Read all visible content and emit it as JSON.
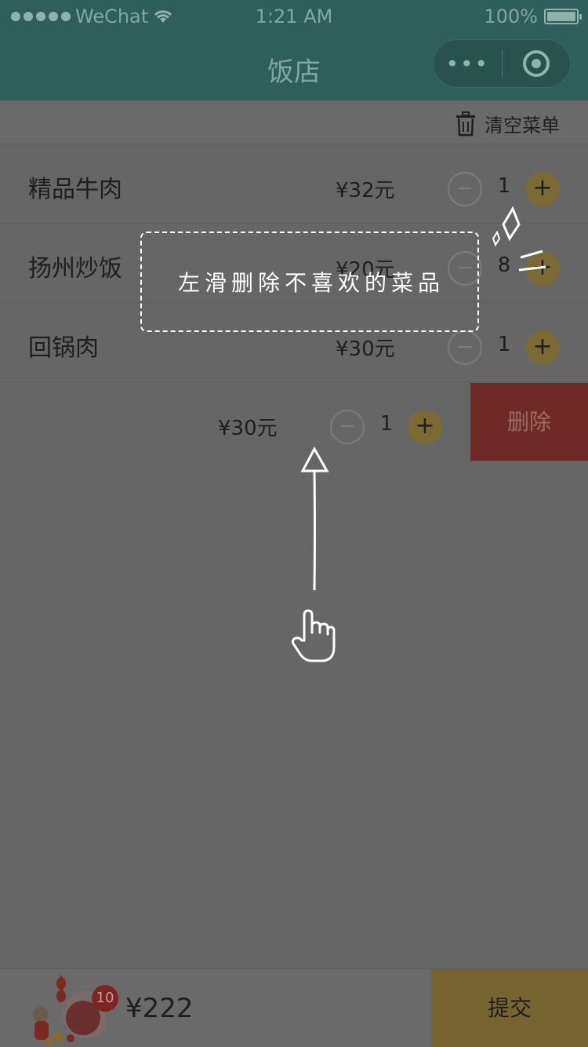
{
  "status_bar": {
    "carrier": "WeChat",
    "time": "1:21 AM",
    "battery": "100%"
  },
  "nav": {
    "title": "饭店",
    "more_label": "•••"
  },
  "toolbar": {
    "clear_label": "清空菜单"
  },
  "menu_items": [
    {
      "name": "精品牛肉",
      "price": "¥32元",
      "qty": "1",
      "minus": "−",
      "plus": "+"
    },
    {
      "name": "扬州炒饭",
      "price": "¥20元",
      "qty": "8",
      "minus": "−",
      "plus": "+"
    },
    {
      "name": "回锅肉",
      "price": "¥30元",
      "qty": "1",
      "minus": "−",
      "plus": "+"
    },
    {
      "name": "",
      "price": "¥30元",
      "qty": "1",
      "minus": "−",
      "plus": "+"
    }
  ],
  "swipe_delete_label": "删除",
  "tip": {
    "text": "左滑删除不喜欢的菜品"
  },
  "cart": {
    "badge": "10",
    "total": "¥222",
    "submit_label": "提交"
  },
  "colors": {
    "overlay": "#666666",
    "nav": "#2f5f5a",
    "accent": "#766531",
    "delete": "#6f2a26"
  }
}
